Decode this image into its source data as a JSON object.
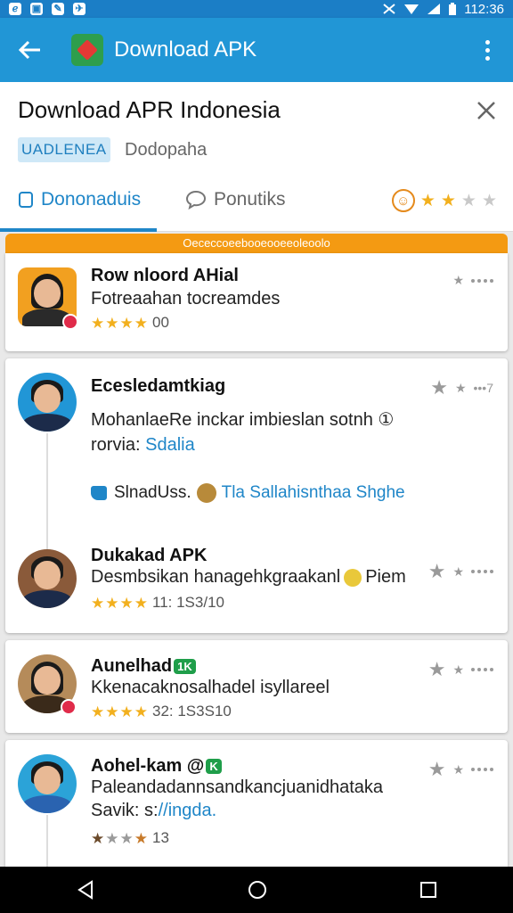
{
  "status_bar": {
    "time": "112:36",
    "left_icons": [
      "ℯ",
      "▣",
      "✎",
      "✈"
    ]
  },
  "app_bar": {
    "title": "Download APK",
    "back_icon": "arrow-left-icon",
    "overflow_icon": "more-vert-icon"
  },
  "header": {
    "title": "Download APR Indonesia",
    "chip_label": "UADLENEA",
    "chip_secondary": "Dodopaha",
    "tabs": [
      {
        "label": "Dononaduis",
        "active": true
      },
      {
        "label": "Ponutiks",
        "active": false
      }
    ],
    "tab_rating_stars": 2
  },
  "banner": {
    "text": "Oececcoeebooeooeeoleoolo"
  },
  "reviews": [
    {
      "name": "Row nloord AHial",
      "desc": "Fotreaahan tocreamdes",
      "rating": 4,
      "rating_text": "00"
    },
    {
      "name": "Ecesledamtkiag",
      "desc_line1": "MohanlaeRe inckar imbieslan sotnh ①",
      "desc_line2_prefix": "rorvia: ",
      "desc_line2_link": "Sdalia",
      "menu_text": "•••7",
      "action_left": "SlnadUss.",
      "action_right": "Tla Sallahisnthaa Shghe"
    },
    {
      "name": "Dukakad APK",
      "desc": "Desmbsikan hanagehkgraakanl",
      "desc_suffix": "Piem",
      "rating": 4,
      "rating_text": "11: 1S3/10"
    },
    {
      "name": "Aunelhad",
      "name_badge": "1K",
      "desc": "Kkenacaknosalhadel isyllareel",
      "rating": 4,
      "rating_text": "32: 1S3S10"
    },
    {
      "name": "Aohel-kam @",
      "name_badge": "K",
      "desc": "Paleandadannsandkancjuanidhataka",
      "desc_line2_prefix": "Savik: s:",
      "desc_line2_link": "//ingda.",
      "rating_text": "13"
    }
  ]
}
